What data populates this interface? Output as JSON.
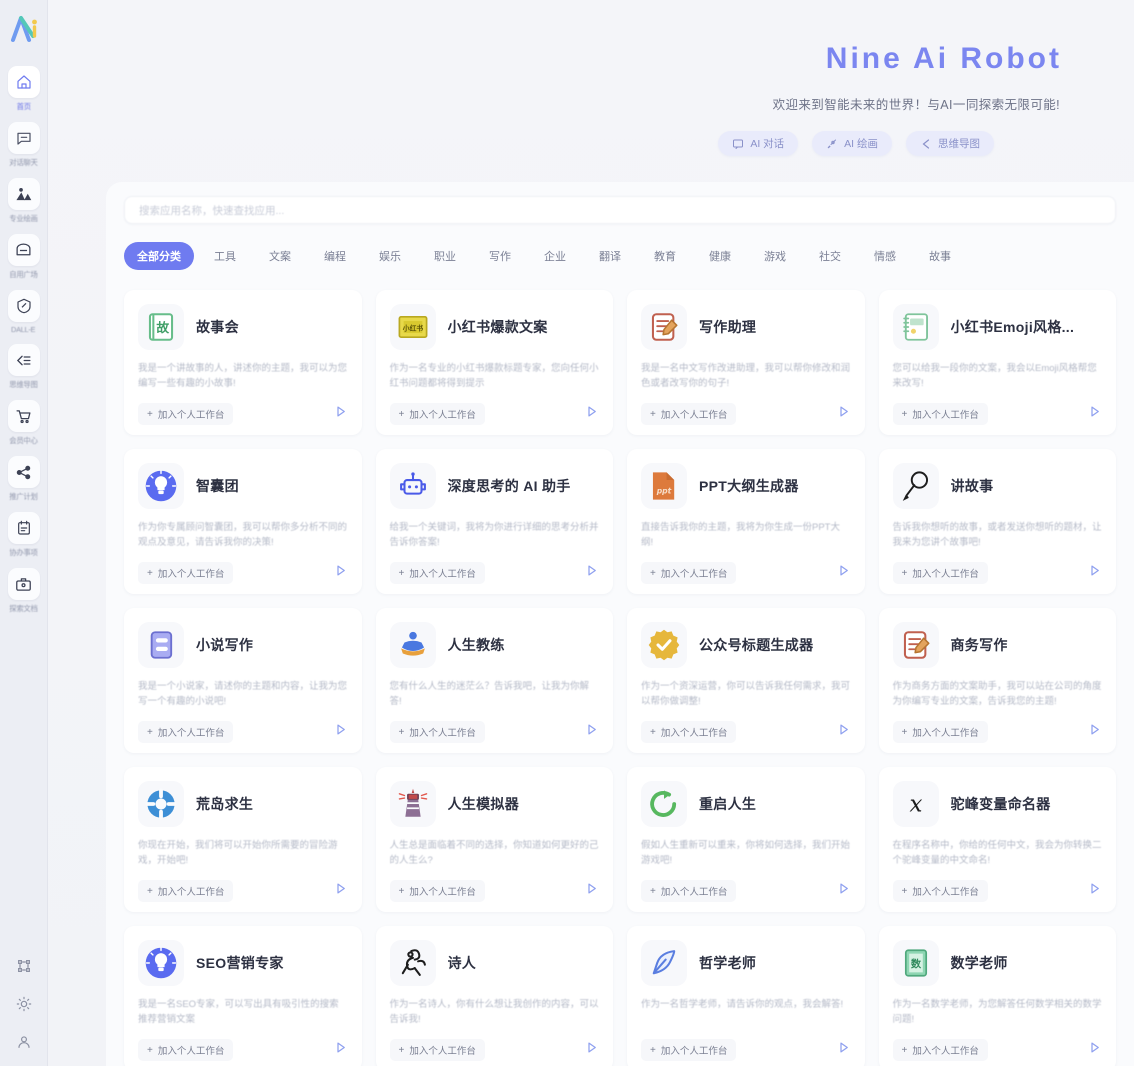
{
  "sidebar": {
    "logo": "nine-ai-logo",
    "items": [
      {
        "label": "首页",
        "icon": "home-icon",
        "active": true
      },
      {
        "label": "对话聊天",
        "icon": "chat-icon",
        "active": false
      },
      {
        "label": "专业绘画",
        "icon": "image-icon",
        "active": false
      },
      {
        "label": "自用广场",
        "icon": "mail-icon",
        "active": false
      },
      {
        "label": "DALL-E",
        "icon": "dalle-icon",
        "active": false
      },
      {
        "label": "思维导图",
        "icon": "mindmap-icon",
        "active": false
      },
      {
        "label": "会员中心",
        "icon": "cart-icon",
        "active": false
      },
      {
        "label": "推广计划",
        "icon": "share-icon",
        "active": false
      },
      {
        "label": "协办事项",
        "icon": "clipboard-icon",
        "active": false
      },
      {
        "label": "探索文档",
        "icon": "briefcase-icon",
        "active": false
      }
    ],
    "bottom_items": [
      {
        "label": "应用",
        "icon": "apps-icon"
      },
      {
        "label": "主题",
        "icon": "sun-icon"
      },
      {
        "label": "用户",
        "icon": "user-icon"
      }
    ]
  },
  "hero": {
    "title": "Nine Ai Robot",
    "subtitle": "欢迎来到智能未来的世界！与AI一同探索无限可能!",
    "chips": [
      {
        "label": "AI 对话",
        "icon": "chat-bubble-icon"
      },
      {
        "label": "AI 绘画",
        "icon": "brush-icon"
      },
      {
        "label": "思维导图",
        "icon": "share-nodes-icon"
      }
    ]
  },
  "search": {
    "placeholder": "搜索应用名称，快速查找应用...",
    "value": ""
  },
  "tabs": [
    {
      "label": "全部分类",
      "active": true
    },
    {
      "label": "工具",
      "active": false
    },
    {
      "label": "文案",
      "active": false
    },
    {
      "label": "编程",
      "active": false
    },
    {
      "label": "娱乐",
      "active": false
    },
    {
      "label": "职业",
      "active": false
    },
    {
      "label": "写作",
      "active": false
    },
    {
      "label": "企业",
      "active": false
    },
    {
      "label": "翻译",
      "active": false
    },
    {
      "label": "教育",
      "active": false
    },
    {
      "label": "健康",
      "active": false
    },
    {
      "label": "游戏",
      "active": false
    },
    {
      "label": "社交",
      "active": false
    },
    {
      "label": "情感",
      "active": false
    },
    {
      "label": "故事",
      "active": false
    }
  ],
  "card_common": {
    "join_label": "加入个人工作台",
    "plus": "+",
    "play_icon": "play-triangle-icon"
  },
  "cards": [
    {
      "title": "故事会",
      "desc": "我是一个讲故事的人，讲述你的主题，我可以为您编写一些有趣的小故事!",
      "icon": "green-book-icon"
    },
    {
      "title": "小红书爆款文案",
      "desc": "作为一名专业的小红书爆款标题专家，您向任何小红书问题都将得到提示",
      "icon": "xiaohongshu-icon"
    },
    {
      "title": "写作助理",
      "desc": "我是一名中文写作改进助理，我可以帮你修改和润色或者改写你的句子!",
      "icon": "writing-pad-icon"
    },
    {
      "title": "小红书Emoji风格...",
      "desc": "您可以给我一段你的文案，我会以Emoji风格帮您来改写!",
      "icon": "notebook-icon"
    },
    {
      "title": "智囊团",
      "desc": "作为你专属顾问智囊团，我可以帮你多分析不同的观点及意见，请告诉我你的决策!",
      "icon": "bulb-blue-icon"
    },
    {
      "title": "深度思考的 AI 助手",
      "desc": "给我一个关键词，我将为你进行详细的思考分析并告诉你答案!",
      "icon": "robot-icon"
    },
    {
      "title": "PPT大纲生成器",
      "desc": "直接告诉我你的主题，我将为你生成一份PPT大纲!",
      "icon": "ppt-file-icon"
    },
    {
      "title": "讲故事",
      "desc": "告诉我你想听的故事，或者发送你想听的题材，让我来为您讲个故事吧!",
      "icon": "magnifier-pen-icon"
    },
    {
      "title": "小说写作",
      "desc": "我是一个小说家，请述你的主题和内容，让我为您写一个有趣的小说吧!",
      "icon": "purple-notebook-icon"
    },
    {
      "title": "人生教练",
      "desc": "您有什么人生的迷茫么？告诉我吧，让我为你解答!",
      "icon": "muscle-icon"
    },
    {
      "title": "公众号标题生成器",
      "desc": "作为一个资深运营，你可以告诉我任何需求，我可以帮你做调整!",
      "icon": "gold-badge-icon"
    },
    {
      "title": "商务写作",
      "desc": "作为商务方面的文案助手，我可以站在公司的角度为你编写专业的文案，告诉我您的主题!",
      "icon": "red-writing-pad-icon"
    },
    {
      "title": "荒岛求生",
      "desc": "你现在开始，我们将可以开始你所需要的冒险游戏，开始吧!",
      "icon": "lifebuoy-icon"
    },
    {
      "title": "人生模拟器",
      "desc": "人生总是面临着不同的选择，你知道如何更好的己的人生么?",
      "icon": "lighthouse-icon"
    },
    {
      "title": "重启人生",
      "desc": "假如人生重新可以重来，你将如何选择，我们开始游戏吧!",
      "icon": "green-refresh-icon"
    },
    {
      "title": "驼峰变量命名器",
      "desc": "在程序名称中，你给的任何中文，我会为你转换二个驼峰变量的中文命名!",
      "icon": "x-variable-icon"
    },
    {
      "title": "SEO营销专家",
      "desc": "我是一名SEO专家，可以写出具有吸引性的搜索推荐营销文案",
      "icon": "bulb-seo-icon"
    },
    {
      "title": "诗人",
      "desc": "作为一名诗人，你有什么想让我创作的内容，可以告诉我!",
      "icon": "poet-icon"
    },
    {
      "title": "哲学老师",
      "desc": "作为一名哲学老师，请告诉你的观点，我会解答!",
      "icon": "quill-icon"
    },
    {
      "title": "数学老师",
      "desc": "作为一名数学老师，为您解答任何数学相关的数学问题!",
      "icon": "math-book-icon"
    }
  ],
  "colors": {
    "accent": "#6f7bf0",
    "title": "#7b86f0",
    "panel_bg": "#fafbfd",
    "sidebar_bg": "#eceef4"
  }
}
